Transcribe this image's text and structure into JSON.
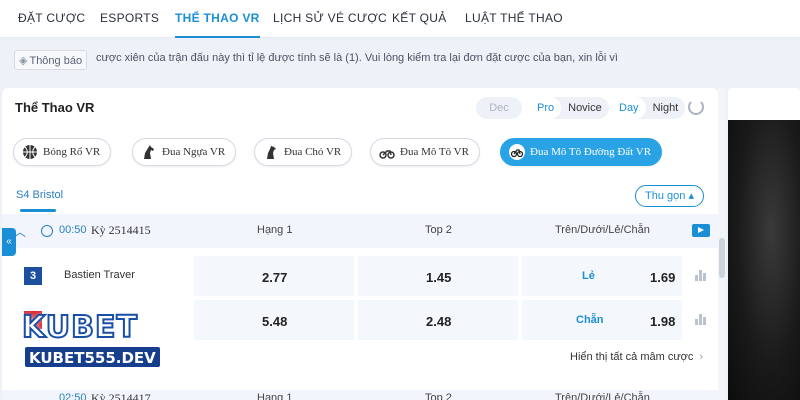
{
  "nav": {
    "items": [
      {
        "label": "ĐẶT CƯỢC"
      },
      {
        "label": "ESPORTS"
      },
      {
        "label": "THỂ THAO VR"
      },
      {
        "label": "LỊCH SỬ VÉ CƯỢC"
      },
      {
        "label": "KẾT QUẢ"
      },
      {
        "label": "LUẬT THỂ THAO"
      }
    ],
    "active_index": 2
  },
  "notice": {
    "badge_label": "Thông báo",
    "text": "cược xiên của trận đấu này thì tỉ lệ được tính sẽ là (1). Vui lòng kiểm tra lại đơn đặt cược của bạn, xin lỗi vì"
  },
  "panel": {
    "title": "Thể Thao VR",
    "odds_format": {
      "dec": "Dec"
    },
    "mode": {
      "pro": "Pro",
      "novice": "Novice",
      "selected": "Pro"
    },
    "theme": {
      "day": "Day",
      "night": "Night",
      "selected": "Day"
    }
  },
  "sports": [
    {
      "label": "Bóng Rổ VR",
      "icon": "basketball-icon"
    },
    {
      "label": "Đua Ngựa VR",
      "icon": "horse-icon"
    },
    {
      "label": "Đua Chó VR",
      "icon": "dog-icon"
    },
    {
      "label": "Đua Mô Tô VR",
      "icon": "motorbike-icon"
    },
    {
      "label": "Đua Mô Tô Đường Đất VR",
      "icon": "dirtbike-icon",
      "active": true
    }
  ],
  "track": {
    "name": "S4 Bristol",
    "collapse_label": "Thu gọn"
  },
  "race": {
    "time": "00:50",
    "round": "Kỳ 2514415",
    "columns": [
      "Hạng 1",
      "Top 2",
      "Trên/Dưới/Lẻ/Chẵn"
    ],
    "rows": [
      {
        "num": "3",
        "num_color": "#1d4fa0",
        "name": "Bastien Traver",
        "win": "2.77",
        "top2": "1.45",
        "tag": "Lẻ",
        "tag_odds": "1.69"
      },
      {
        "num": "",
        "num_color": "#d8262e",
        "name": "",
        "win": "5.48",
        "top2": "2.48",
        "tag": "Chẵn",
        "tag_odds": "1.98"
      }
    ],
    "show_all": "Hiển thị tất cả mâm cược"
  },
  "next_race": {
    "time": "02:50",
    "round": "Kỳ 2514417",
    "columns": [
      "Hạng 1",
      "Top 2",
      "Trên/Dưới/Lẻ/Chẵn"
    ]
  },
  "logo": {
    "brand": "KUBET",
    "domain": "KUBET555.DEV"
  }
}
